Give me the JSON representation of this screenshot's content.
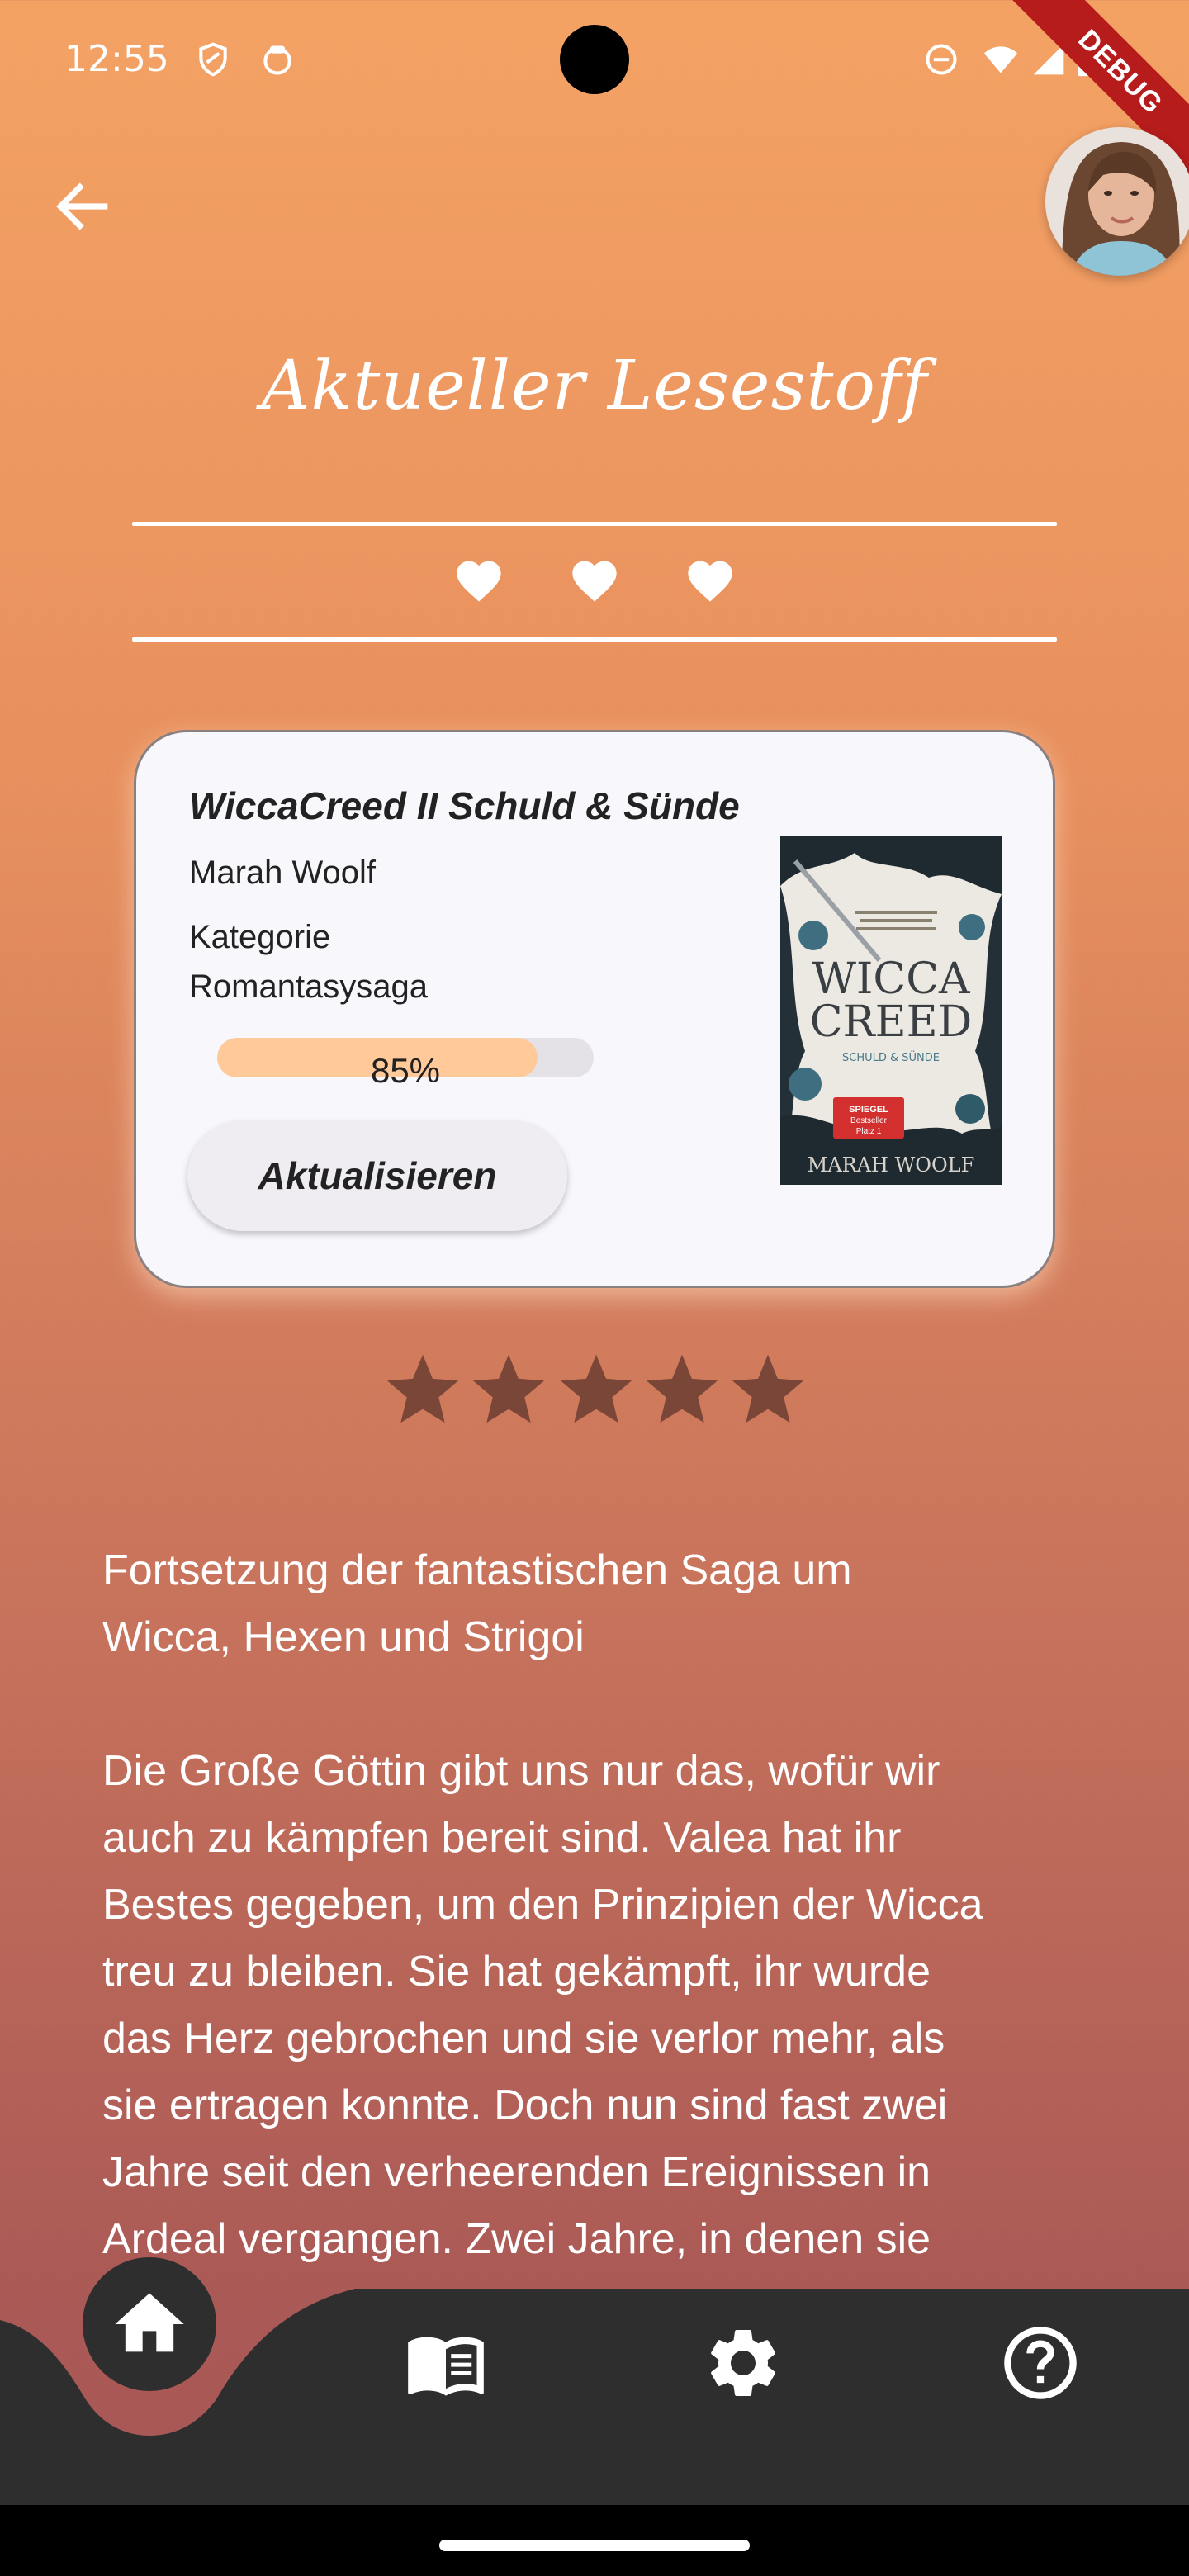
{
  "status_bar": {
    "time": "12:55",
    "debug": "DEBUG"
  },
  "header": {
    "title": "Aktueller Lesestoff"
  },
  "book": {
    "title": "WiccaCreed II Schuld & Sünde",
    "author": "Marah Woolf",
    "category_label": "Kategorie",
    "category": "Romantasysaga",
    "progress": 0.85,
    "progress_text": "85%",
    "update_button": "Aktualisieren",
    "rating": 5
  },
  "description": "Fortsetzung der fantastischen Saga um\nWicca, Hexen und Strigoi\n\nDie Große Göttin gibt uns nur das, wofür wir\nauch zu kämpfen bereit sind. Valea hat ihr\nBestes gegeben, um den Prinzipien der Wicca\ntreu zu bleiben. Sie hat gekämpft, ihr wurde\ndas Herz gebrochen und sie verlor mehr, als\nsie ertragen konnte. Doch nun sind fast zwei\nJahre seit den verheerenden Ereignissen in\nArdeal vergangen. Zwei Jahre, in denen sie\nsich vor der Welt der Menschen versteckt und",
  "nav": {
    "items": [
      {
        "icon": "home-icon",
        "active": true
      },
      {
        "icon": "book-icon",
        "active": false
      },
      {
        "icon": "gear-icon",
        "active": false
      },
      {
        "icon": "help-icon",
        "active": false
      }
    ]
  },
  "colors": {
    "gradient_top": "#f4a264",
    "gradient_bottom": "#a65656",
    "nav_bg": "#2e2e2e",
    "progress_fill": "#ffc999",
    "star": "#7a4638"
  }
}
